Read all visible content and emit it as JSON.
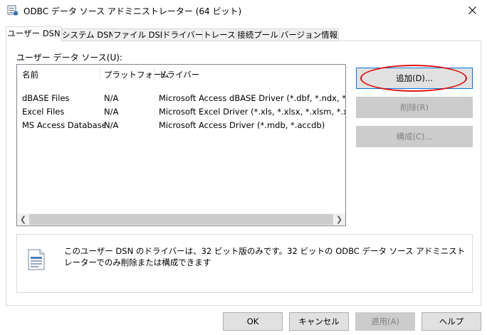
{
  "window": {
    "title": "ODBC データ ソース アドミニストレーター (64 ビット)"
  },
  "tabs": [
    {
      "label": "ユーザー DSN",
      "active": true
    },
    {
      "label": "システム DSN"
    },
    {
      "label": "ファイル DSN"
    },
    {
      "label": "ドライバー"
    },
    {
      "label": "トレース"
    },
    {
      "label": "接続プール"
    },
    {
      "label": "バージョン情報"
    }
  ],
  "user_dsn": {
    "list_label": "ユーザー データ ソース(U):",
    "columns": [
      "名前",
      "プラットフォーム",
      "ドライバー"
    ],
    "rows": [
      {
        "name": "dBASE Files",
        "platform": "N/A",
        "driver": "Microsoft Access dBASE Driver (*.dbf, *.ndx, *.mdx)"
      },
      {
        "name": "Excel Files",
        "platform": "N/A",
        "driver": "Microsoft Excel Driver (*.xls, *.xlsx, *.xlsm, *.xlsb)"
      },
      {
        "name": "MS Access Database",
        "platform": "N/A",
        "driver": "Microsoft Access Driver (*.mdb, *.accdb)"
      }
    ],
    "buttons": {
      "add": "追加(D)...",
      "remove": "削除(R)",
      "configure": "構成(C)..."
    },
    "info_text": "このユーザー DSN のドライバーは、32 ビット版のみです。32 ビットの ODBC データ ソース アドミニストレーターでのみ削除または構成できます"
  },
  "footer": {
    "ok": "OK",
    "cancel": "キャンセル",
    "apply": "適用(A)",
    "help": "ヘルプ"
  },
  "icons": {
    "app": "odbc-admin-icon",
    "close": "close-icon",
    "info": "database-document-icon"
  },
  "colors": {
    "highlight_ellipse": "#e01010",
    "focus_border": "#0078d7"
  }
}
